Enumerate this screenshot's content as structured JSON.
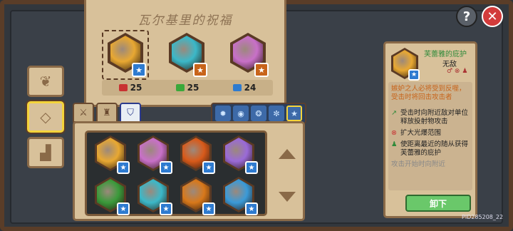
{
  "blessing": {
    "title": "瓦尔基里的祝福",
    "slots": [
      {
        "icon": "golden-shield-icon",
        "color": "#e8a832",
        "badge": "star-badge-icon",
        "badge_color": "#2e7bd0"
      },
      {
        "icon": "cyan-shield-icon",
        "color": "#3bb8c8",
        "badge": "orange-ring-badge-icon",
        "badge_color": "#c8641a"
      },
      {
        "icon": "pink-wind-icon",
        "color": "#c870c8",
        "badge": "orange-spark-badge-icon",
        "badge_color": "#c8641a"
      }
    ],
    "stats": [
      {
        "icon": "red-gem-icon",
        "color": "#c83232",
        "value": "25"
      },
      {
        "icon": "green-leaf-icon",
        "color": "#3aa83a",
        "value": "25"
      },
      {
        "icon": "blue-book-icon",
        "color": "#2e7bd0",
        "value": "24"
      }
    ]
  },
  "side_menu": [
    {
      "name": "side-leaf-button",
      "glyph": "❦"
    },
    {
      "name": "side-diamond-button",
      "glyph": "◇",
      "active": true
    },
    {
      "name": "side-podium-button",
      "glyph": "▟"
    }
  ],
  "tabs_left": [
    {
      "name": "tab-sword",
      "glyph": "⚔"
    },
    {
      "name": "tab-fortress",
      "glyph": "♜"
    },
    {
      "name": "tab-shield",
      "glyph": "⛉",
      "active": true
    }
  ],
  "tabs_right": [
    {
      "name": "filter-fire-icon",
      "glyph": "✹"
    },
    {
      "name": "filter-shield-icon",
      "glyph": "◉"
    },
    {
      "name": "filter-wind-icon",
      "glyph": "❂"
    },
    {
      "name": "filter-tree-icon",
      "glyph": "✼"
    },
    {
      "name": "filter-star-icon",
      "glyph": "★",
      "active": true
    }
  ],
  "inventory": [
    {
      "icon": "golden-shield-icon",
      "color": "#e8a832"
    },
    {
      "icon": "pink-wind-icon",
      "color": "#c870c8"
    },
    {
      "icon": "fire-ring-icon",
      "color": "#d85a1a"
    },
    {
      "icon": "purple-cross-icon",
      "color": "#9a6ad8"
    },
    {
      "icon": "green-pit-icon",
      "color": "#3a9a3a"
    },
    {
      "icon": "cyan-shield-icon",
      "color": "#3bb8c8"
    },
    {
      "icon": "lantern-icon",
      "color": "#d8781a"
    },
    {
      "icon": "lightning-icon",
      "color": "#3a9ad8"
    }
  ],
  "detail": {
    "icon": "golden-shield-icon",
    "icon_color": "#e8a832",
    "name": "芙蕾雅的庇护",
    "type": "无敌",
    "tag_icons": "♂ ⊗ ♟",
    "description": "嫉妒之人必将受到反噬，受击时将回击攻击者",
    "lines": [
      {
        "marker": "↗",
        "marker_color": "#2f8a3a",
        "text": "受击时向附近敌对单位释放投射物攻击"
      },
      {
        "marker": "⊗",
        "marker_color": "#c83232",
        "text": "扩大光爆范围"
      },
      {
        "marker": "♟",
        "marker_color": "#2f8a3a",
        "text": "使距离最近的随从获得芙蕾雅的庇护"
      }
    ],
    "fade_line": "攻击开始时向附近",
    "unequip_label": "卸下"
  },
  "help_label": "?",
  "close_label": "✕",
  "pid": "PID285208_22"
}
